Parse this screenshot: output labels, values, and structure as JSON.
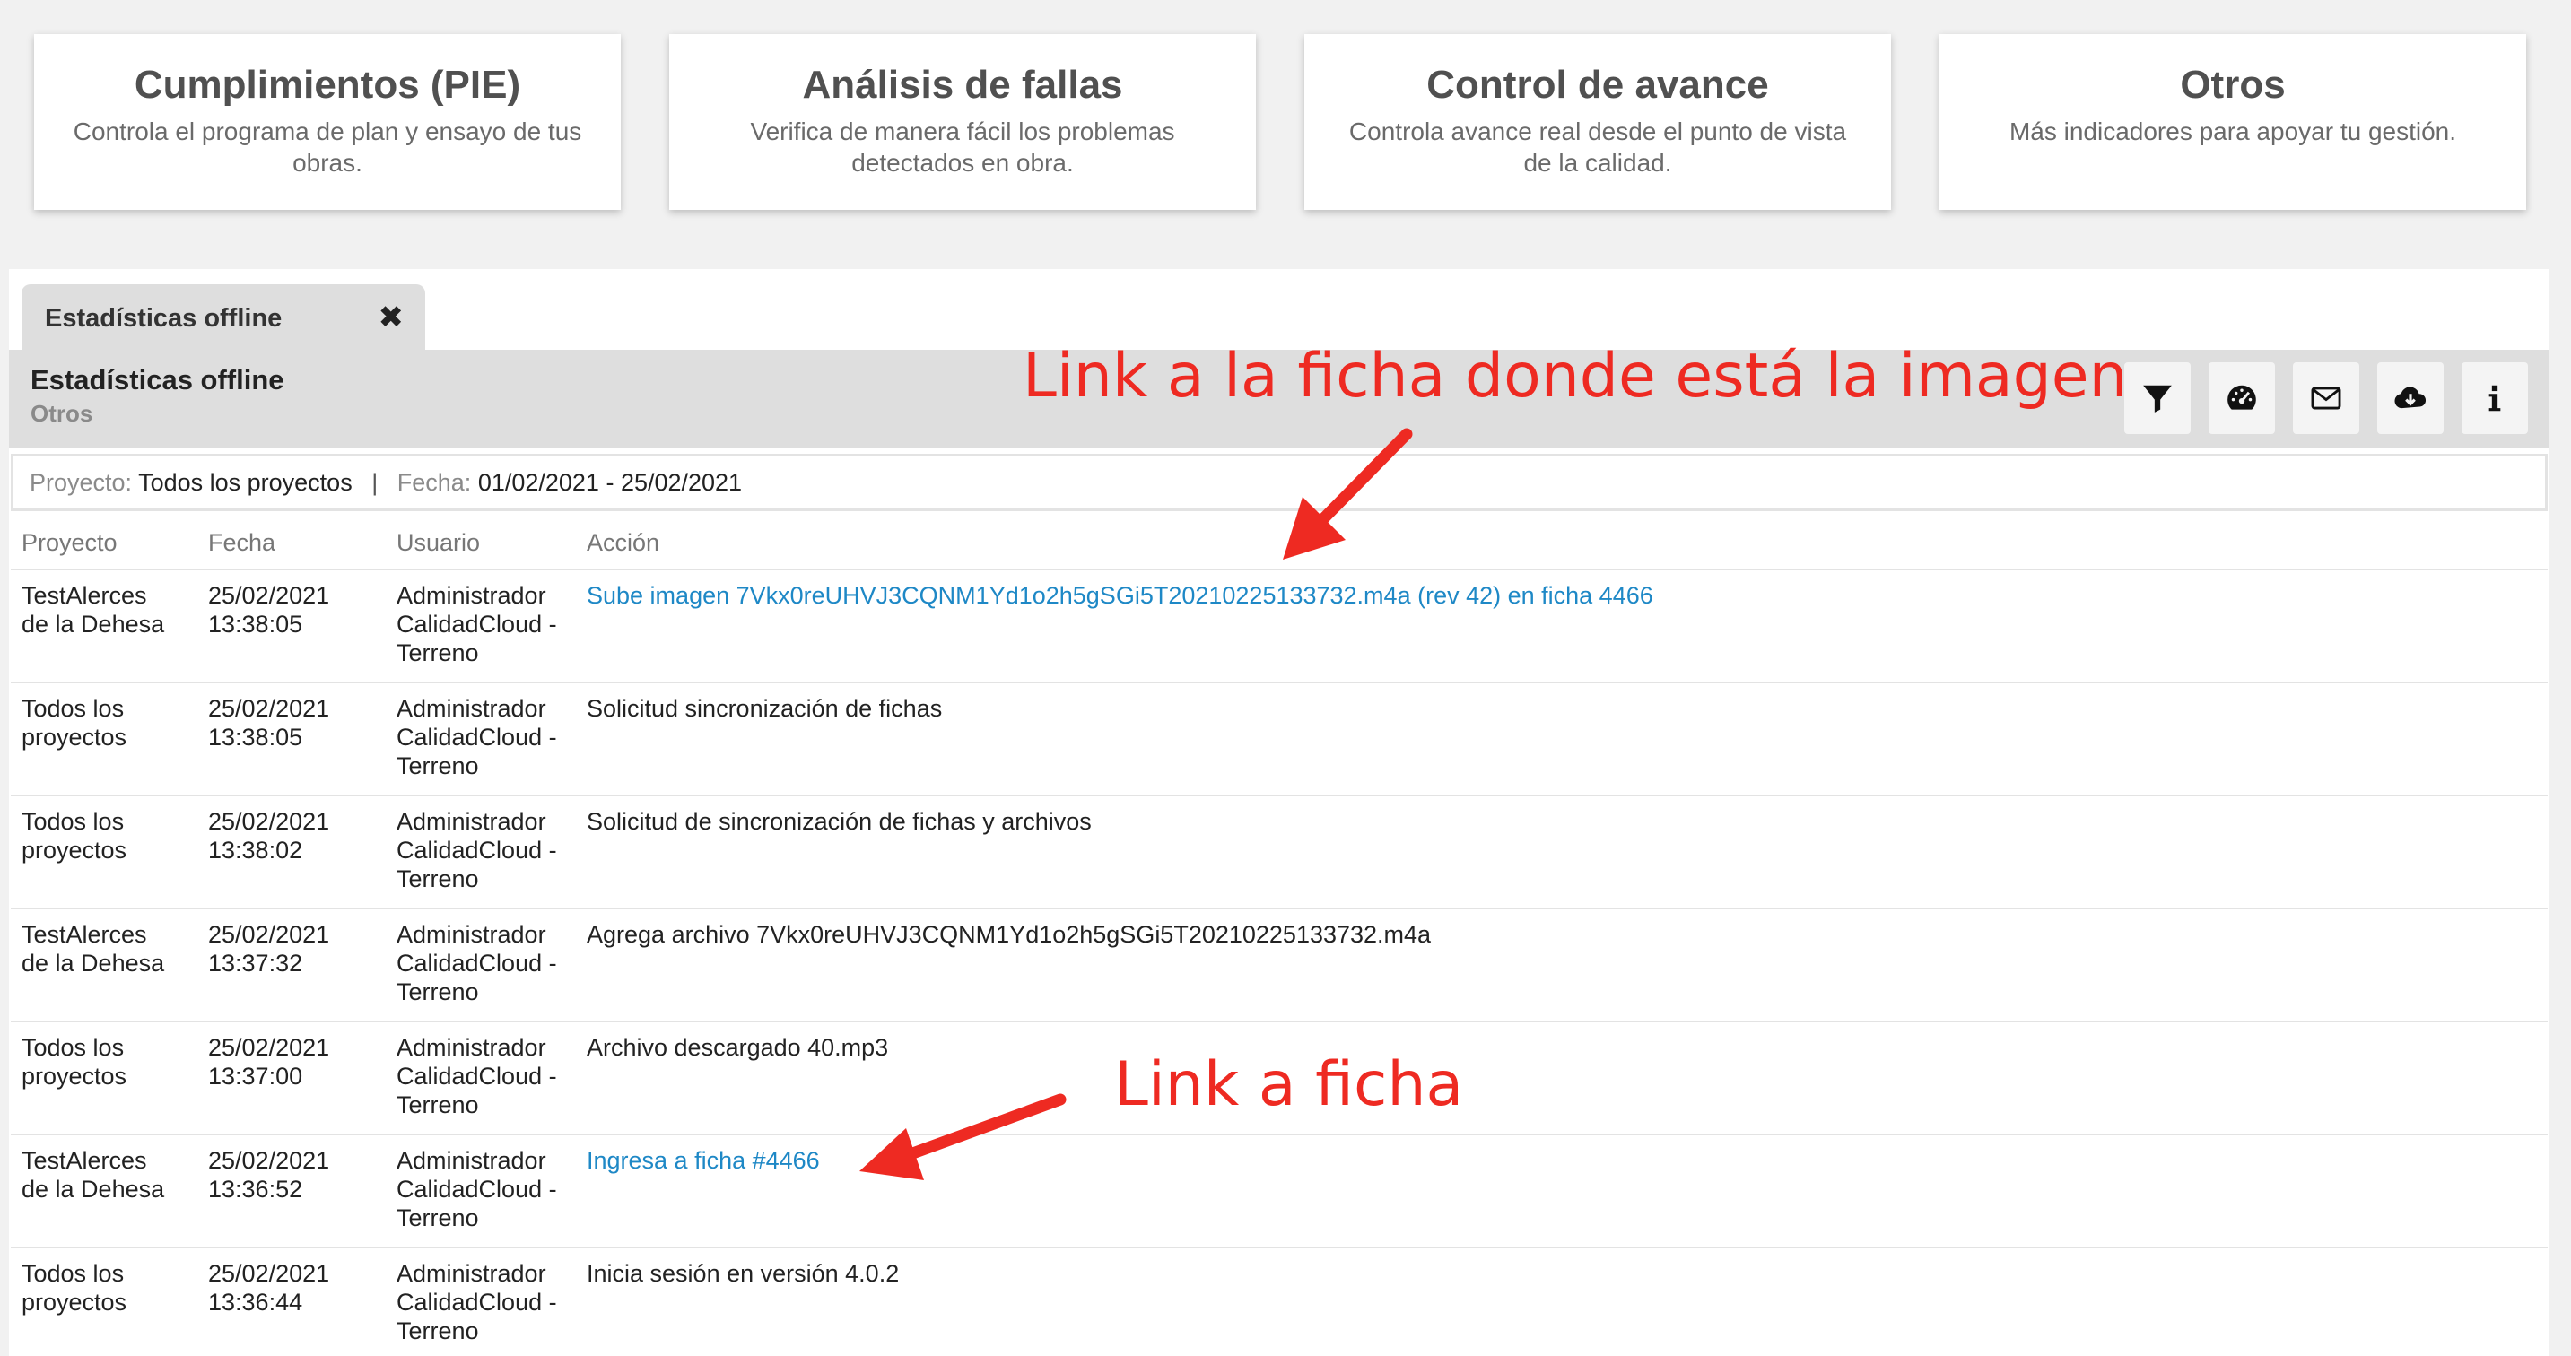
{
  "cards": [
    {
      "title": "Cumplimientos (PIE)",
      "desc": "Controla el programa de plan y ensayo de tus obras."
    },
    {
      "title": "Análisis de fallas",
      "desc": "Verifica de manera fácil los problemas detectados en obra."
    },
    {
      "title": "Control de avance",
      "desc": "Controla avance real desde el punto de vista de la calidad."
    },
    {
      "title": "Otros",
      "desc": "Más indicadores para apoyar tu gestión."
    }
  ],
  "tab": {
    "label": "Estadísticas offline",
    "close": "✖"
  },
  "header": {
    "title": "Estadísticas offline",
    "subtitle": "Otros"
  },
  "toolbar": {
    "icons": [
      "filter-icon",
      "dashboard-gauge-icon",
      "envelope-icon",
      "cloud-download-icon",
      "info-icon"
    ]
  },
  "filter": {
    "project_label": "Proyecto:",
    "project_value": "Todos los proyectos",
    "separator": "|",
    "date_label": "Fecha:",
    "date_value": "01/02/2021 - 25/02/2021"
  },
  "table": {
    "headers": {
      "proyecto": "Proyecto",
      "fecha": "Fecha",
      "usuario": "Usuario",
      "accion": "Acción"
    },
    "rows": [
      {
        "proyecto1": "TestAlerces",
        "proyecto2": "de la Dehesa",
        "fecha1": "25/02/2021",
        "fecha2": "13:38:05",
        "user1": "Administrador",
        "user2": "CalidadCloud -",
        "user3": "Terreno",
        "accion": "Sube imagen 7Vkx0reUHVJ3CQNM1Yd1o2h5gSGi5T20210225133732.m4a (rev 42) en ficha 4466",
        "link": true
      },
      {
        "proyecto1": "Todos los",
        "proyecto2": "proyectos",
        "fecha1": "25/02/2021",
        "fecha2": "13:38:05",
        "user1": "Administrador",
        "user2": "CalidadCloud -",
        "user3": "Terreno",
        "accion": "Solicitud sincronización de fichas",
        "link": false
      },
      {
        "proyecto1": "Todos los",
        "proyecto2": "proyectos",
        "fecha1": "25/02/2021",
        "fecha2": "13:38:02",
        "user1": "Administrador",
        "user2": "CalidadCloud -",
        "user3": "Terreno",
        "accion": "Solicitud de sincronización de fichas y archivos",
        "link": false
      },
      {
        "proyecto1": "TestAlerces",
        "proyecto2": "de la Dehesa",
        "fecha1": "25/02/2021",
        "fecha2": "13:37:32",
        "user1": "Administrador",
        "user2": "CalidadCloud -",
        "user3": "Terreno",
        "accion": "Agrega archivo 7Vkx0reUHVJ3CQNM1Yd1o2h5gSGi5T20210225133732.m4a",
        "link": false
      },
      {
        "proyecto1": "Todos los",
        "proyecto2": "proyectos",
        "fecha1": "25/02/2021",
        "fecha2": "13:37:00",
        "user1": "Administrador",
        "user2": "CalidadCloud -",
        "user3": "Terreno",
        "accion": "Archivo descargado 40.mp3",
        "link": false
      },
      {
        "proyecto1": "TestAlerces",
        "proyecto2": "de la Dehesa",
        "fecha1": "25/02/2021",
        "fecha2": "13:36:52",
        "user1": "Administrador",
        "user2": "CalidadCloud -",
        "user3": "Terreno",
        "accion": "Ingresa a ficha #4466",
        "link": true
      },
      {
        "proyecto1": "Todos los",
        "proyecto2": "proyectos",
        "fecha1": "25/02/2021",
        "fecha2": "13:36:44",
        "user1": "Administrador",
        "user2": "CalidadCloud -",
        "user3": "Terreno",
        "accion": "Inicia sesión en versión 4.0.2",
        "link": false
      }
    ]
  },
  "annotations": {
    "top": "Link a la ficha donde está la imagen",
    "bottom": "Link a ficha"
  },
  "colors": {
    "link": "#1e88c6",
    "annotation": "#ee2a22",
    "header_bg": "#dedede",
    "page_bg": "#f1f1f1"
  }
}
